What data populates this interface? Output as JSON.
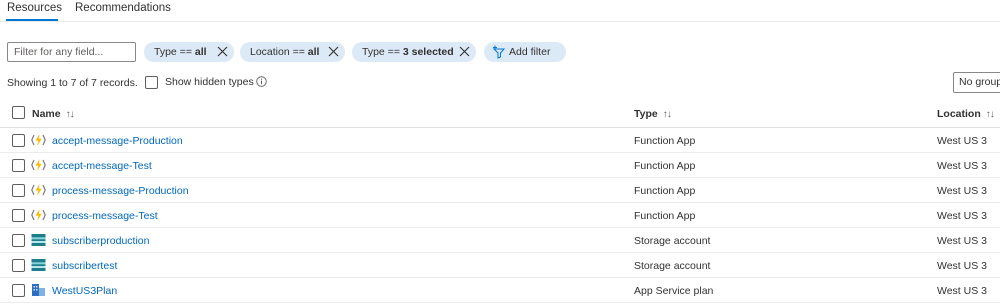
{
  "tabs": [
    {
      "label": "Resources",
      "active": true
    },
    {
      "label": "Recommendations",
      "active": false
    }
  ],
  "filter": {
    "placeholder": "Filter for any field...",
    "pills": [
      {
        "prefix": "Type == ",
        "value": "all"
      },
      {
        "prefix": "Location == ",
        "value": "all"
      },
      {
        "prefix": "Type == ",
        "value": "3 selected"
      }
    ],
    "add_filter_label": "Add filter"
  },
  "records_text": "Showing 1 to 7 of 7 records.",
  "show_hidden_label": "Show hidden types",
  "grouping_value": "No grouping",
  "columns": {
    "name": "Name",
    "type": "Type",
    "location": "Location"
  },
  "rows": [
    {
      "name": "accept-message-Production",
      "type": "Function App",
      "location": "West US 3",
      "icon": "function-app-icon"
    },
    {
      "name": "accept-message-Test",
      "type": "Function App",
      "location": "West US 3",
      "icon": "function-app-icon"
    },
    {
      "name": "process-message-Production",
      "type": "Function App",
      "location": "West US 3",
      "icon": "function-app-icon"
    },
    {
      "name": "process-message-Test",
      "type": "Function App",
      "location": "West US 3",
      "icon": "function-app-icon"
    },
    {
      "name": "subscriberproduction",
      "type": "Storage account",
      "location": "West US 3",
      "icon": "storage-account-icon"
    },
    {
      "name": "subscribertest",
      "type": "Storage account",
      "location": "West US 3",
      "icon": "storage-account-icon"
    },
    {
      "name": "WestUS3Plan",
      "type": "App Service plan",
      "location": "West US 3",
      "icon": "app-service-plan-icon"
    }
  ],
  "colors": {
    "accent": "#0078d4",
    "link": "#0067b8",
    "pill_bg": "#dce9f7"
  }
}
